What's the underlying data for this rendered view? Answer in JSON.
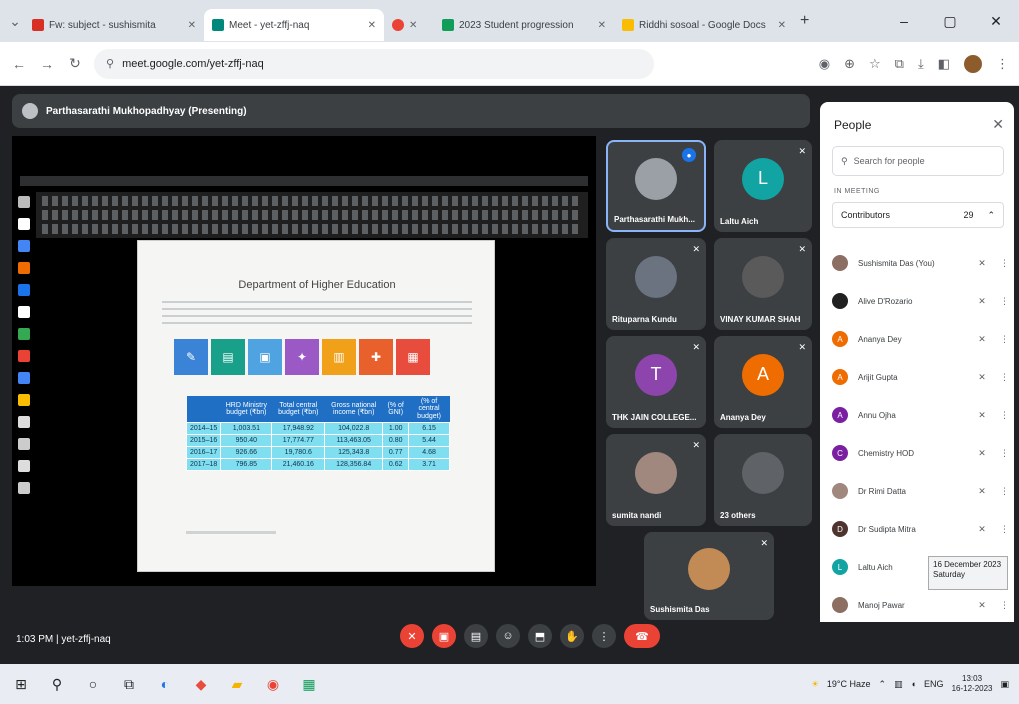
{
  "browser": {
    "tabs": [
      {
        "title": "Fw: subject - sushismita",
        "favicon_color": "#d93025",
        "active": false
      },
      {
        "title": "Meet - yet-zffj-naq",
        "favicon_color": "#00897b",
        "active": true
      },
      {
        "title": "",
        "favicon_color": "#ea4335",
        "active": false
      },
      {
        "title": "2023 Student progression",
        "favicon_color": "#0f9d58",
        "active": false
      },
      {
        "title": "Riddhi sosoal - Google Docs",
        "favicon_color": "#fbbc04",
        "active": false
      }
    ],
    "url": "meet.google.com/yet-zffj-naq",
    "window_controls": [
      "–",
      "▢",
      "✕"
    ]
  },
  "presenter_bar": {
    "label": "Parthasarathi Mukhopadhyay (Presenting)"
  },
  "slide": {
    "title": "Department of Higher Education",
    "tiles": [
      {
        "color": "#3a83d6",
        "icon": "✎"
      },
      {
        "color": "#18a08b",
        "icon": "▤"
      },
      {
        "color": "#4fa3e0",
        "icon": "▣"
      },
      {
        "color": "#9b59c6",
        "icon": "✦"
      },
      {
        "color": "#f0a019",
        "icon": "▥"
      },
      {
        "color": "#e8612c",
        "icon": "✚"
      },
      {
        "color": "#e74c3c",
        "icon": "▦"
      }
    ],
    "table": {
      "headers": [
        "",
        "HRD Ministry budget (₹bn)",
        "Total central budget (₹bn)",
        "Gross national income (₹bn)",
        "(% of GNI)",
        "(% of central budget)"
      ],
      "rows": [
        [
          "2014–15",
          "1,003.51",
          "17,948.92",
          "104,022.8",
          "1.00",
          "6.15"
        ],
        [
          "2015–16",
          "950.40",
          "17,774.77",
          "113,463.05",
          "0.80",
          "5.44"
        ],
        [
          "2016–17",
          "926.66",
          "19,780.6",
          "125,343.8",
          "0.77",
          "4.68"
        ],
        [
          "2017–18",
          "796.85",
          "21,460.16",
          "128,356.84",
          "0.62",
          "3.71"
        ]
      ]
    }
  },
  "participants": [
    {
      "name": "Parthasarathi Mukh...",
      "color": "#9aa0a6",
      "letter": "",
      "speaking": true
    },
    {
      "name": "Laltu Aich",
      "color": "#12a4a2",
      "letter": "L",
      "speaking": false
    },
    {
      "name": "Rituparna Kundu",
      "color": "#6b7280",
      "letter": "",
      "speaking": false
    },
    {
      "name": "VINAY KUMAR SHAH",
      "color": "#5a5a5a",
      "letter": "",
      "speaking": false
    },
    {
      "name": "THK JAIN COLLEGE...",
      "color": "#8e44ad",
      "letter": "T",
      "speaking": false
    },
    {
      "name": "Ananya Dey",
      "color": "#ef6c00",
      "letter": "A",
      "speaking": false
    },
    {
      "name": "sumita nandi",
      "color": "#a1887f",
      "letter": "",
      "speaking": false
    },
    {
      "name": "23 others",
      "color": "#5f6368",
      "letter": "",
      "speaking": false
    },
    {
      "name": "Sushismita Das",
      "color": "#c28b56",
      "letter": "",
      "speaking": false
    }
  ],
  "people_panel": {
    "title": "People",
    "search_placeholder": "Search for people",
    "section": "IN MEETING",
    "contributors_label": "Contributors",
    "contributors_count": "29",
    "list": [
      {
        "name": "Sushismita Das (You)",
        "color": "#8d6e63",
        "letter": ""
      },
      {
        "name": "Alive D'Rozario",
        "color": "#212121",
        "letter": ""
      },
      {
        "name": "Ananya Dey",
        "color": "#ef6c00",
        "letter": "A"
      },
      {
        "name": "Arijit Gupta",
        "color": "#ef6c00",
        "letter": "A"
      },
      {
        "name": "Annu Ojha",
        "color": "#7b1fa2",
        "letter": "A"
      },
      {
        "name": "Chemistry HOD",
        "color": "#7b1fa2",
        "letter": "C"
      },
      {
        "name": "Dr Rimi Datta",
        "color": "#a1887f",
        "letter": ""
      },
      {
        "name": "Dr Sudipta Mitra",
        "color": "#4e342e",
        "letter": "D"
      },
      {
        "name": "Laltu Aich",
        "color": "#12a4a2",
        "letter": "L"
      },
      {
        "name": "Manoj Pawar",
        "color": "#8d6e63",
        "letter": ""
      }
    ]
  },
  "meeting": {
    "time": "1:03 PM",
    "code": "yet-zffj-naq"
  },
  "tooltip": {
    "line1": "16 December 2023",
    "line2": "Saturday"
  },
  "tray": {
    "weather": "19°C Haze",
    "lang": "ENG",
    "time": "13:03",
    "date": "16-12-2023"
  }
}
